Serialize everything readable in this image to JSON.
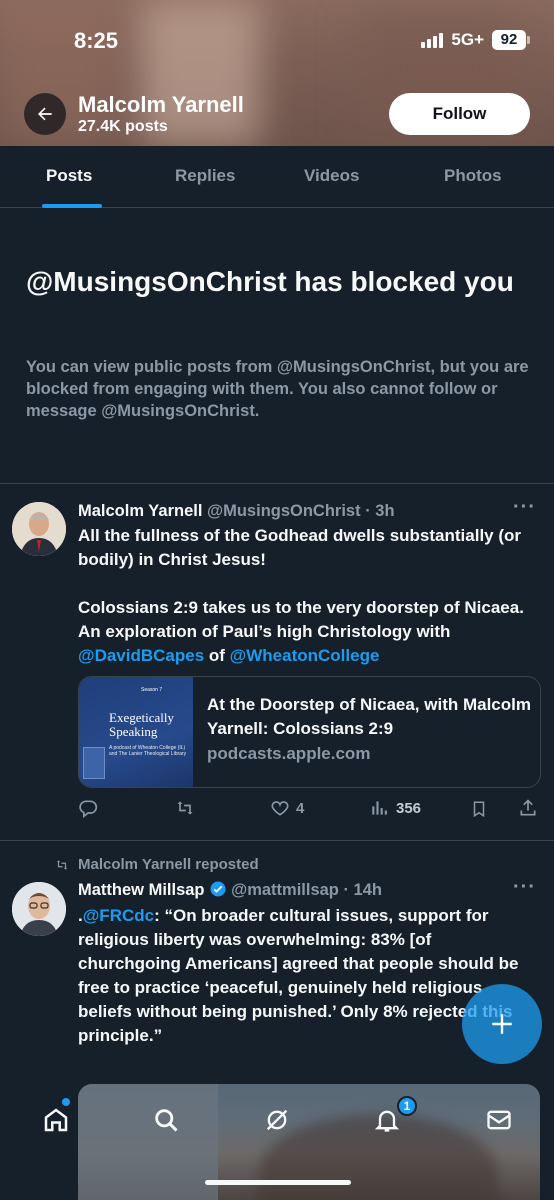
{
  "status_bar": {
    "time": "8:25",
    "network": "5G+",
    "battery": "92"
  },
  "profile": {
    "name": "Malcolm Yarnell",
    "posts_count": "27.4K posts",
    "follow_label": "Follow"
  },
  "tabs": [
    {
      "label": "Posts",
      "active": true
    },
    {
      "label": "Replies",
      "active": false
    },
    {
      "label": "Videos",
      "active": false
    },
    {
      "label": "Photos",
      "active": false
    }
  ],
  "blocked": {
    "title": "@MusingsOnChrist has blocked you",
    "description": "You can view public posts from @MusingsOnChrist, but you are blocked from engaging with them. You also cannot follow or message @MusingsOnChrist."
  },
  "tweet1": {
    "name": "Malcolm Yarnell",
    "handle_time": "@MusingsOnChrist · 3h",
    "text_line1": "All the fullness of the Godhead dwells substantially (or bodily) in Christ Jesus!",
    "text_p2_pre": "Colossians 2:9 takes us to the very doorstep of Nicaea. An exploration of Paul’s high Christology with ",
    "mention1": "@DavidBCapes",
    "text_mid": " of ",
    "mention2": "@WheatonCollege",
    "card": {
      "title": "At the Doorstep of Nicaea, with Malcolm Yarnell: Colossians 2:9",
      "domain": "podcasts.apple.com",
      "thumb_season": "Season 7",
      "thumb_title": "Exegetically Speaking",
      "thumb_sub": "A podcast of Wheaton College (IL) and The Lanier Theological Library"
    },
    "likes": "4",
    "views": "356"
  },
  "repost_label": "Malcolm Yarnell reposted",
  "tweet2": {
    "name": "Matthew Millsap",
    "handle_time": "@mattmillsap · 14h",
    "prefix": ".",
    "mention": "@FRCdc",
    "text": ": “On broader cultural issues, support for religious liberty was overwhelming: 83% [of churchgoing Americans] agreed that people should be free to practice ‘peaceful, genuinely held religious beliefs without being punished.’ Only 8% rejected this principle.”"
  },
  "nav": {
    "notifications_badge": "1"
  },
  "colors": {
    "background": "#15202b",
    "accent": "#1d9bf0",
    "muted": "#8b98a5",
    "text": "#f7f9f9"
  }
}
